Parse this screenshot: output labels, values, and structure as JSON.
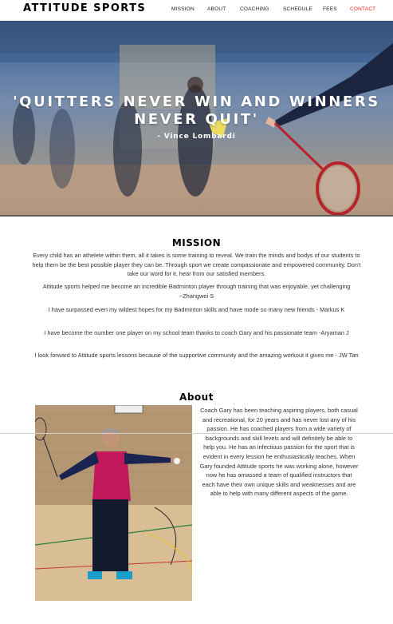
{
  "header": {
    "logo": "ATTITUDE SPORTS",
    "nav": [
      "MISSION",
      "ABOUT",
      "COACHING",
      "SCHEDULE",
      "FEES",
      "CONTACT"
    ],
    "active_color": "#e31e24"
  },
  "hero": {
    "quote": "'QUITTERS NEVER WIN AND WINNERS NEVER QUIT'",
    "author": "- Vince Lombardi"
  },
  "mission": {
    "title": "MISSION",
    "paragraphs": [
      "Every child has an athelete within them, all it takes is some training to reveal. We train the minds and bodys of our students to help them be the best possible player they can be. Through sport we create compassionate and empowered community. Don't take our word for it, hear from our satisfied members.",
      "Attitude sports helped me become an incredible Badminton player through training that was enjoyable, yet challenging ~Zhangwei S",
      "I have surpassed even my wildest hopes for my Badminton skills and have mode so many new friends - Markus K",
      "I have become the number one player on my school team thanks to coach Gary and his passionate team -Aryaman J",
      "I look forward to Attitude sports lessons because of the supportive community and the amazing workout it gives me - JW Tan"
    ]
  },
  "about": {
    "title": "About",
    "text": "Coach Gary has been teaching aspiring players, both casual and recreational, for 20 years and has never lost any of his passion. He has coached players from a wide variety of backgrounds and skill levels and will definitely be able to help you. He has an infectious passion for the sport that is evident in every lession he enthusiastically teaches. When Gary founded Attitude sports he was working alone, however now he has amassed a team of qualified instructors that each have their own unique skills and weaknesses and are able to help with many different aspects of the game."
  }
}
